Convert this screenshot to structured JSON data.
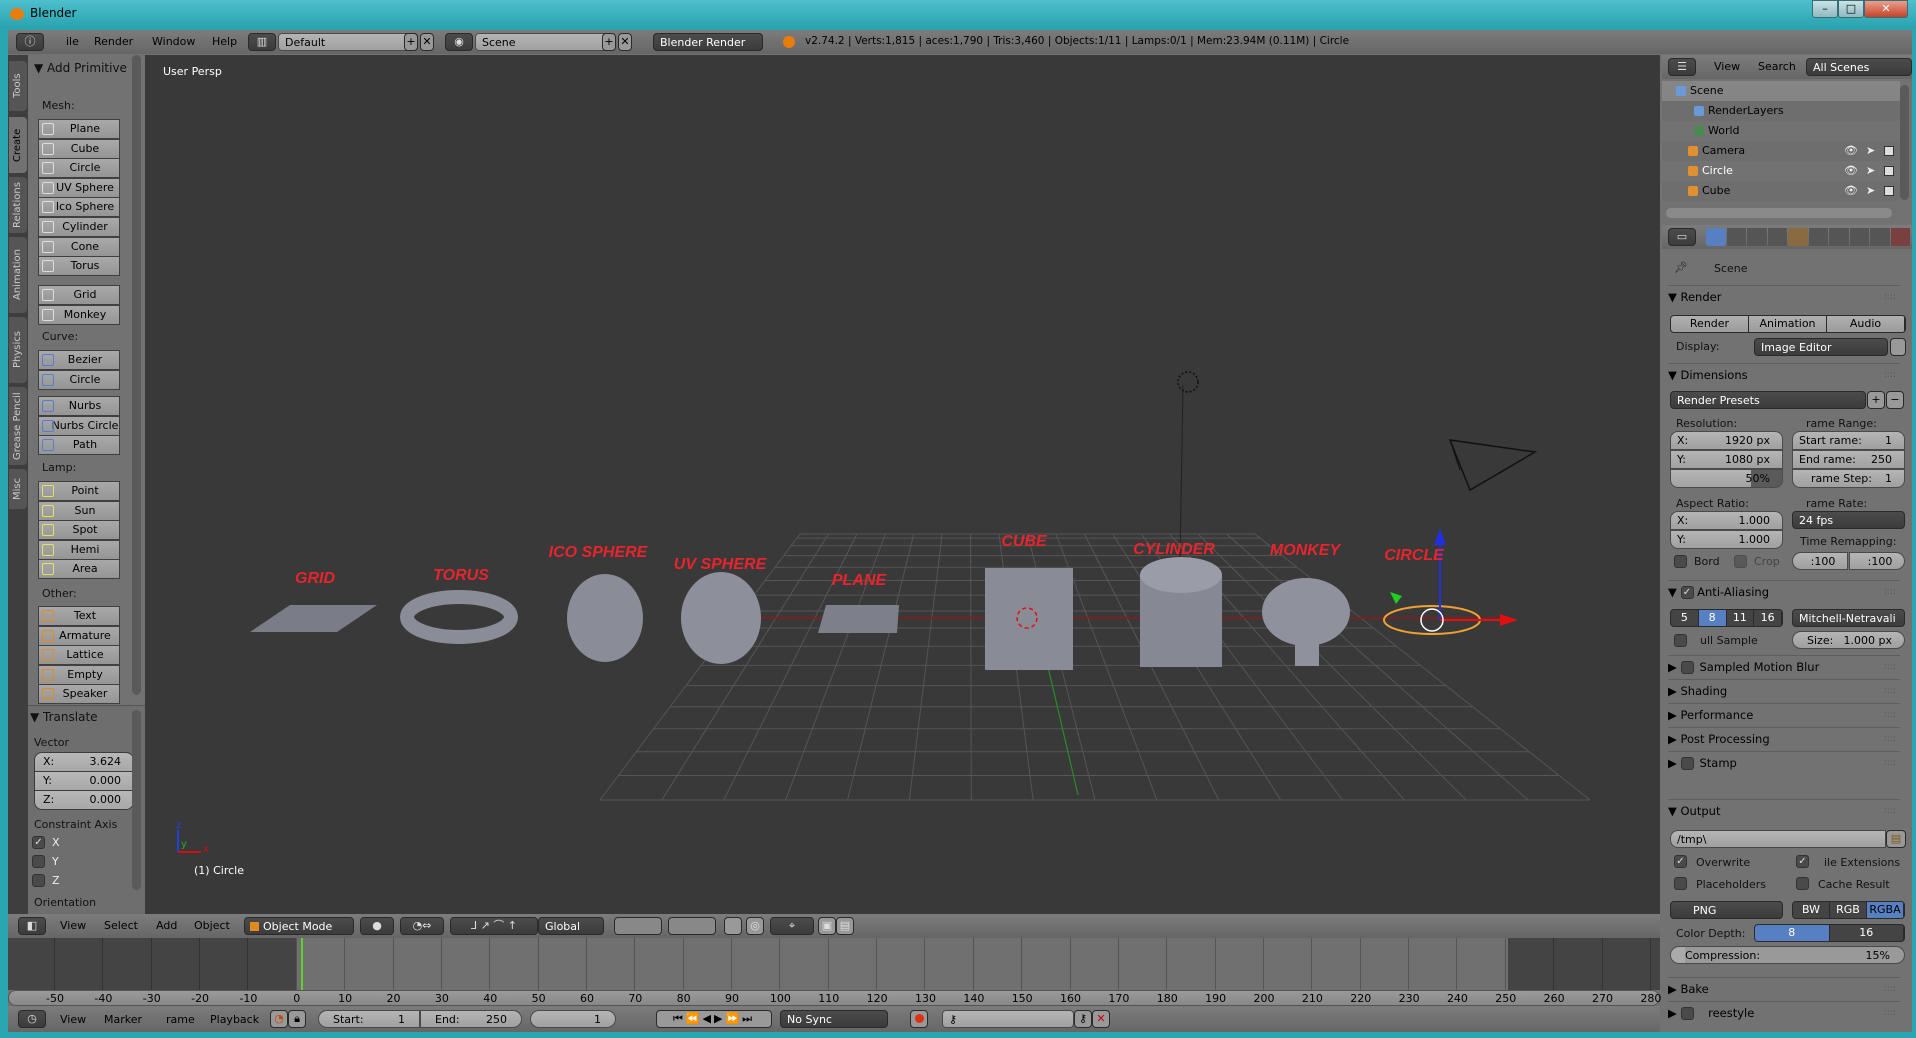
{
  "window": {
    "title": "Blender",
    "controls": [
      "–",
      "□",
      "✕"
    ]
  },
  "topbar": {
    "menus": [
      "ile",
      "Render",
      "Window",
      "Help"
    ],
    "layout": "Default",
    "scene": "Scene",
    "engine": "Blender Render",
    "stats": "v2.74.2 | Verts:1,815 |  aces:1,790 | Tris:3,460 | Objects:1/11 | Lamps:0/1 | Mem:23.94M (0.11M) | Circle"
  },
  "toolshelf": {
    "tabs": [
      "Tools",
      "Create",
      "Relations",
      "Animation",
      "Physics",
      "Grease Pencil",
      "Misc"
    ],
    "active_tab": "Create",
    "panel_title": "Add Primitive",
    "groups": [
      {
        "label": "Mesh:",
        "items": [
          "Plane",
          "Cube",
          "Circle",
          "UV Sphere",
          "Ico Sphere",
          "Cylinder",
          "Cone",
          "Torus"
        ]
      },
      {
        "label": "",
        "items": [
          "Grid",
          "Monkey"
        ]
      },
      {
        "label": "Curve:",
        "items": [
          "Bezier",
          "Circle"
        ]
      },
      {
        "label": "",
        "items": [
          "Nurbs Curve",
          "Nurbs Circle",
          "Path"
        ]
      },
      {
        "label": "Lamp:",
        "items": [
          "Point",
          "Sun",
          "Spot",
          "Hemi",
          "Area"
        ]
      },
      {
        "label": "Other:",
        "items": [
          "Text",
          "Armature",
          "Lattice",
          "Empty",
          "Speaker"
        ]
      }
    ]
  },
  "operator": {
    "title": "Translate",
    "vector_label": "Vector",
    "vector": [
      {
        "axis": "X:",
        "value": "3.624"
      },
      {
        "axis": "Y:",
        "value": "0.000"
      },
      {
        "axis": "Z:",
        "value": "0.000"
      }
    ],
    "constraint_label": "Constraint Axis",
    "constraints": [
      {
        "axis": "X",
        "checked": true
      },
      {
        "axis": "Y",
        "checked": false
      },
      {
        "axis": "Z",
        "checked": false
      }
    ],
    "orientation_label": "Orientation"
  },
  "viewport": {
    "view_name": "User Persp",
    "active_object": "(1) Circle",
    "axis_labels": {
      "x": "x",
      "y": "y",
      "z": "z"
    },
    "object_labels": [
      "GRID",
      "TORUS",
      "ICO SPHERE",
      "UV SPHERE",
      "PLANE",
      "CUBE",
      "CYLINDER",
      "MONKEY",
      "CIRCLE"
    ],
    "label_color": "#e8242c"
  },
  "viewport_header": {
    "menus": [
      "View",
      "Select",
      "Add",
      "Object"
    ],
    "mode": "Object Mode",
    "orientation": "Global"
  },
  "timeline": {
    "ticks": [
      -50,
      -40,
      -30,
      -20,
      -10,
      0,
      10,
      20,
      30,
      40,
      50,
      60,
      70,
      80,
      90,
      100,
      110,
      120,
      130,
      140,
      150,
      160,
      170,
      180,
      190,
      200,
      210,
      220,
      230,
      240,
      250,
      260,
      270,
      280
    ],
    "current_frame": 1,
    "menus": [
      "View",
      "Marker",
      "rame",
      "Playback"
    ],
    "start_label": "Start:",
    "start": "1",
    "end_label": "End:",
    "end": "250",
    "frame": "1",
    "sync": "No Sync"
  },
  "outliner": {
    "menus": [
      "View",
      "Search"
    ],
    "filter": "All Scenes",
    "rows": [
      "Scene",
      "RenderLayers",
      "World",
      "Camera",
      "Circle",
      "Cube"
    ]
  },
  "properties": {
    "context": "Scene",
    "render": {
      "title": "Render",
      "buttons": [
        "Render",
        "Animation",
        "Audio"
      ],
      "display_label": "Display:",
      "display": "Image Editor"
    },
    "dimensions": {
      "title": "Dimensions",
      "presets": "Render Presets",
      "resolution_label": "Resolution:",
      "res_x": "1920 px",
      "res_y": "1080 px",
      "res_pct": "50%",
      "res_pct_value": 50,
      "frame_range_label": "rame Range:",
      "start_label": "Start  rame:",
      "start": "1",
      "end_label": "End  rame:",
      "end": "250",
      "step_label": "rame Step:",
      "step": "1",
      "aspect_label": "Aspect Ratio:",
      "asp_x": "1.000",
      "asp_y": "1.000",
      "frame_rate_label": "rame Rate:",
      "frame_rate": "24 fps",
      "remap_label": "Time Remapping:",
      "remap_old": ":100",
      "remap_new": ":100",
      "border": "Bord",
      "crop": "Crop",
      "x_label": "X:",
      "y_label": "Y:"
    },
    "antialiasing": {
      "title": "Anti-Aliasing",
      "enabled": true,
      "samples": [
        "5",
        "8",
        "11",
        "16"
      ],
      "selected": "8",
      "filter": "Mitchell-Netravali",
      "full_sample": "ull Sample",
      "size_label": "Size:",
      "size": "1.000 px"
    },
    "collapsed": [
      "Sampled Motion Blur",
      "Shading",
      "Performance",
      "Post Processing",
      "Stamp"
    ],
    "output": {
      "title": "Output",
      "path": "/tmp\\",
      "overwrite": "Overwrite",
      "file_ext": "ile Extensions",
      "placeholders": "Placeholders",
      "cache": "Cache Result",
      "format": "PNG",
      "color_modes": [
        "BW",
        "RGB",
        "RGBA"
      ],
      "color_mode": "RGBA",
      "depth_label": "Color Depth:",
      "depths": [
        "8",
        "16"
      ],
      "depth": "8",
      "compression_label": "Compression:",
      "compression": "15%",
      "compression_value": 15
    },
    "tail": [
      "Bake",
      "reestyle"
    ],
    "accent": "#5680c2"
  }
}
